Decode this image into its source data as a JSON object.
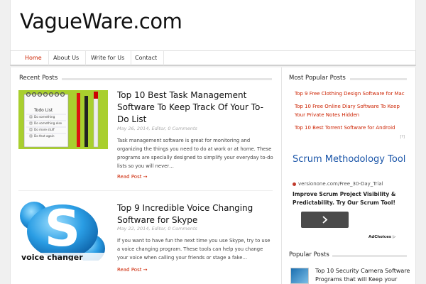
{
  "site": {
    "title": "VagueWare.com"
  },
  "nav": {
    "items": [
      {
        "label": "Home"
      },
      {
        "label": "About Us"
      },
      {
        "label": "Write for Us"
      },
      {
        "label": "Contact"
      }
    ]
  },
  "recent_posts": {
    "heading": "Recent Posts",
    "posts": [
      {
        "title": "Top 10 Best Task Management Software To Keep Track Of Your To-Do List",
        "meta": "May 26, 2014, Editor, 0 Comments",
        "excerpt": "Task management software is great for monitoring and organizing the things you need to do at work or at home. These programs are specially designed to simplify your everyday to-do lists so you will never…",
        "read_more": "Read Post →",
        "thumb": {
          "heading": "Todo List",
          "items": [
            "Do something",
            "Do something else",
            "Do more stuff",
            "Do that again"
          ]
        }
      },
      {
        "title": "Top 9 Incredible Voice Changing Software for Skype",
        "meta": "May 22, 2014, Editor, 0 Comments",
        "excerpt": "If you want to have fun the next time you use Skype, try to use a voice changing program. These tools can help you change your voice when calling your friends or stage a fake…",
        "read_more": "Read Post →",
        "thumb": {
          "caption": "voice changer"
        }
      }
    ]
  },
  "most_popular": {
    "heading": "Most Popular Posts",
    "links": [
      "Top 9 Free Clothing Design Software for Mac",
      "Top 10 Free Online Diary Software To Keep Your Private Notes Hidden",
      "Top 10 Best Torrent Software for Android"
    ]
  },
  "ad": {
    "marker": "[?]",
    "title": "Scrum Methodology Tool",
    "url": "versionone.com/Free_30-Day_Trial",
    "description": "Improve Scrum Project Visibility & Predictability. Try Our Scrum Tool!",
    "button_icon": "chevron-right-icon",
    "choices": "AdChoices ▷"
  },
  "popular_posts": {
    "heading": "Popular Posts",
    "first_title": "Top 10 Security Camera Software Programs that will Keep your"
  },
  "colors": {
    "accent": "#cc2200",
    "ad_blue": "#1a55a8"
  }
}
